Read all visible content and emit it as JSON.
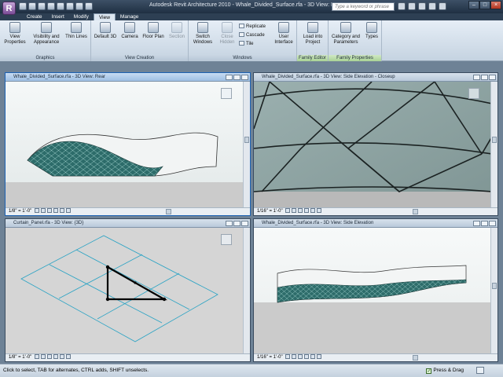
{
  "title_bar": {
    "app_button": "R",
    "title": "Autodesk Revit Architecture 2010 - Whale_Divided_Surface.rfa - 3D View: Rear",
    "search_placeholder": "Type a keyword or phrase",
    "window_buttons": [
      "–",
      "□",
      "×"
    ]
  },
  "ribbon_tabs": [
    "Create",
    "Insert",
    "Modify",
    "View",
    "Manage"
  ],
  "active_tab": "View",
  "ribbon": {
    "graphics": {
      "label": "Graphics",
      "buttons": [
        "View Properties",
        "Visibility and Appearance",
        "Thin Lines"
      ]
    },
    "view_creation": {
      "label": "View Creation",
      "buttons": [
        "Default 3D",
        "Camera",
        "Floor Plan",
        "Section"
      ]
    },
    "windows": {
      "label": "Windows",
      "switch": "Switch Windows",
      "close_hidden": "Close Hidden",
      "replicate": "Replicate",
      "cascade": "Cascade",
      "tile": "Tile",
      "user_interface": "User Interface"
    },
    "family_editor": {
      "label": "Family Editor",
      "buttons": [
        "Load into Project"
      ]
    },
    "family_properties": {
      "label": "Family Properties",
      "buttons": [
        "Category and Parameters",
        "Types"
      ]
    }
  },
  "views": [
    {
      "title": "Whale_Divided_Surface.rfa - 3D View: Rear",
      "scale": "1/8\" = 1'-0\""
    },
    {
      "title": "Whale_Divided_Surface.rfa - 3D View: Side Elevation - Closeup",
      "scale": "1/16\" = 1'-0\""
    },
    {
      "title": "Curtain_Panel.rfa - 3D View: {3D}",
      "scale": "1/8\" = 1'-0\""
    },
    {
      "title": "Whale_Divided_Surface.rfa - 3D View: Side Elevation",
      "scale": "1/16\" = 1'-0\""
    }
  ],
  "status": {
    "message": "Click to select, TAB for alternates, CTRL adds, SHIFT unselects.",
    "press_drag": "Press & Drag",
    "press_drag_checked": true
  },
  "colors": {
    "titlebar": "#2b3b4e",
    "active_view_border": "#1b61b3",
    "panel_mesh": "#2a6a66",
    "ground": "#cbcbcb",
    "closeup_bg": "#8fa3a3",
    "curtain_grid": "#2aa3c4"
  }
}
